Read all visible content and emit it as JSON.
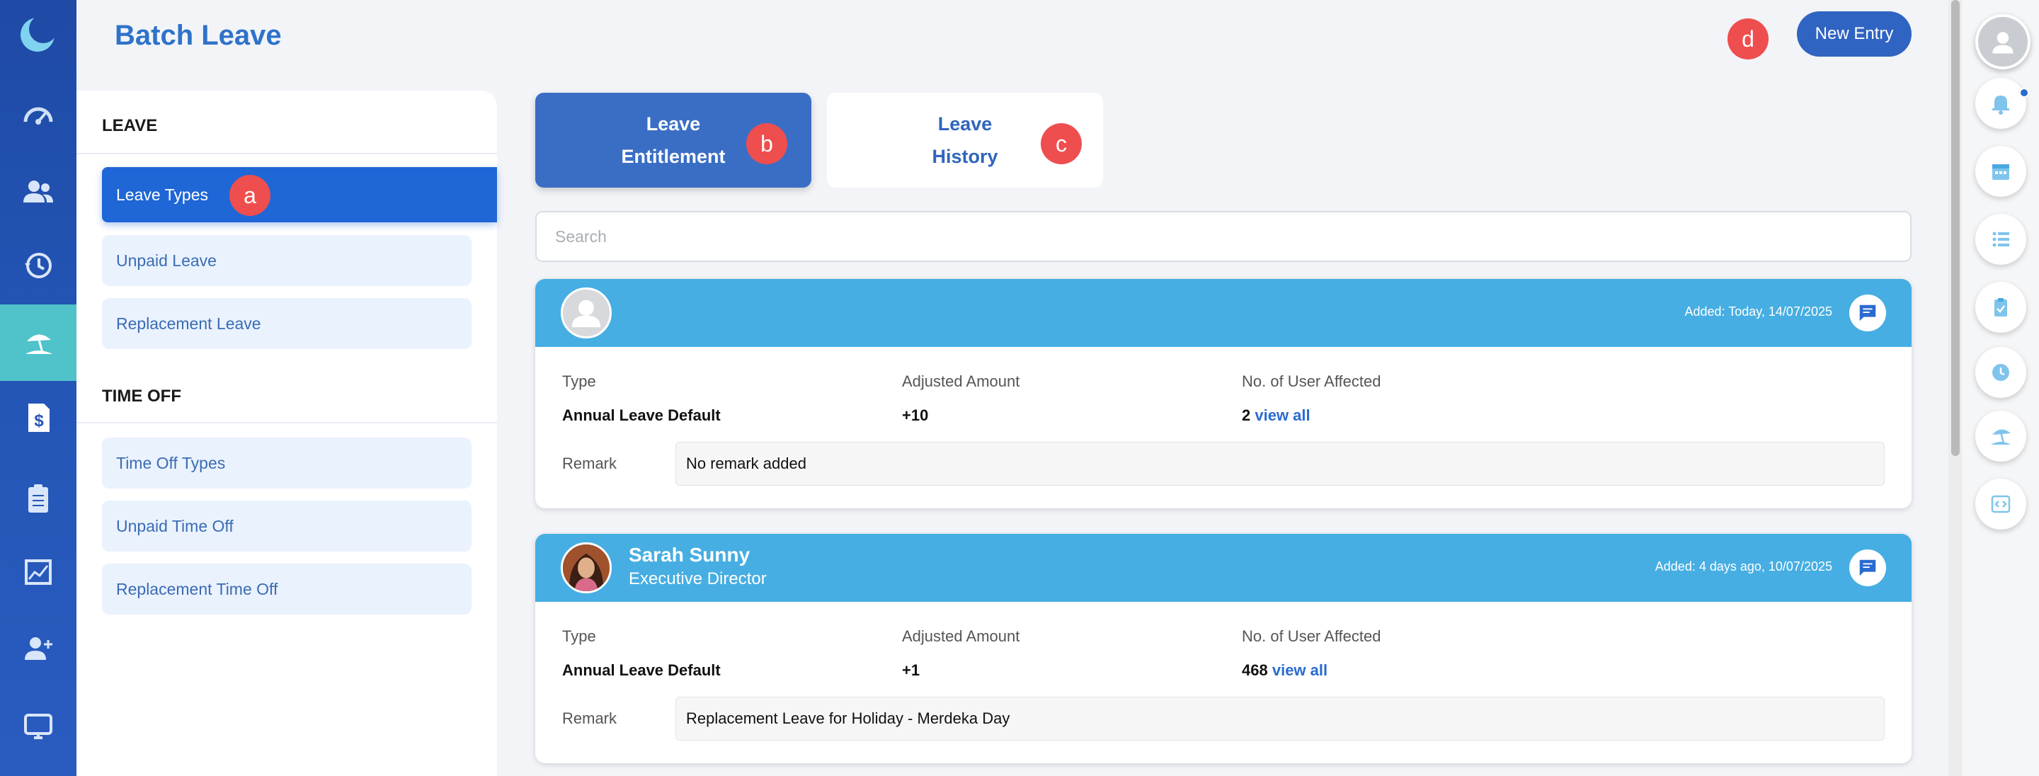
{
  "header": {
    "title": "Batch Leave",
    "new_entry_label": "New Entry"
  },
  "markers": {
    "a": "a",
    "b": "b",
    "c": "c",
    "d": "d"
  },
  "left_nav": {
    "leave_section": "LEAVE",
    "leave_items": [
      "Leave Types",
      "Unpaid Leave",
      "Replacement Leave"
    ],
    "timeoff_section": "TIME OFF",
    "timeoff_items": [
      "Time Off Types",
      "Unpaid Time Off",
      "Replacement Time Off"
    ]
  },
  "tabs": {
    "entitlement_line1": "Leave",
    "entitlement_line2": "Entitlement",
    "history_line1": "Leave",
    "history_line2": "History"
  },
  "search": {
    "placeholder": "Search"
  },
  "labels": {
    "type": "Type",
    "adjusted_amount": "Adjusted Amount",
    "users_affected": "No. of User Affected",
    "remark": "Remark",
    "view_all": "view all"
  },
  "entries": [
    {
      "name": "",
      "role": "",
      "added": "Added: Today, 14/07/2025",
      "type": "Annual Leave Default",
      "adjusted": "+10",
      "users": "2",
      "remark": "No remark added"
    },
    {
      "name": "Sarah Sunny",
      "role": "Executive Director",
      "added": "Added: 4 days ago, 10/07/2025",
      "type": "Annual Leave Default",
      "adjusted": "+1",
      "users": "468",
      "remark": "Replacement Leave for Holiday - Merdeka Day"
    }
  ],
  "colors": {
    "rail": "#2456b7",
    "rail_active": "#4fc3c9",
    "accent": "#2f72c9",
    "card_header": "#46aee2",
    "marker": "#ef4e4e"
  },
  "icons": {
    "rail": [
      "moon-logo-icon",
      "dashboard-gauge-icon",
      "people-icon",
      "history-clock-icon",
      "leave-beach-icon",
      "payroll-dollar-icon",
      "clipboard-icon",
      "chart-icon",
      "add-user-icon",
      "monitor-icon"
    ],
    "right": [
      "profile-avatar-icon",
      "bell-icon",
      "calendar-icon",
      "list-icon",
      "checklist-icon",
      "clock-icon",
      "beach-icon",
      "code-icon"
    ]
  }
}
